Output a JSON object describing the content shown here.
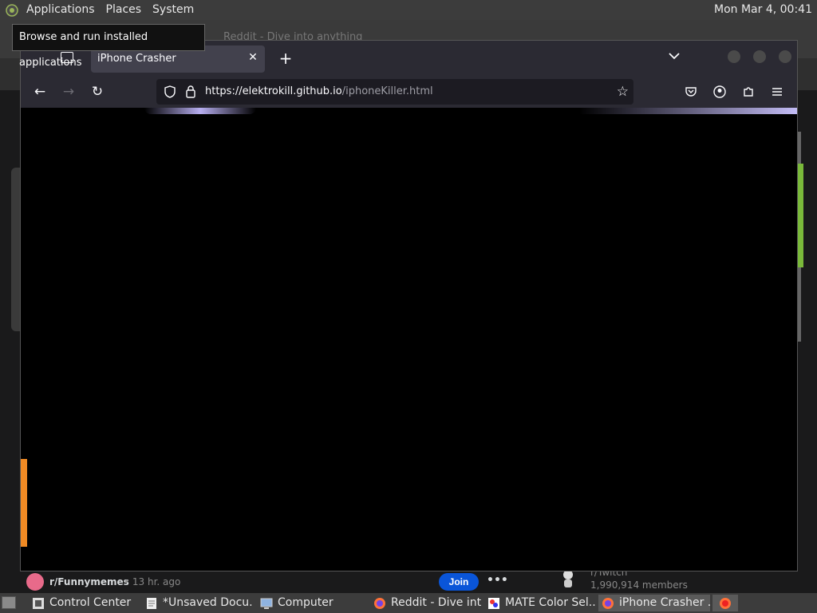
{
  "top_panel": {
    "menus": [
      "Applications",
      "Places",
      "System"
    ],
    "clock": "Mon Mar  4, 00:41"
  },
  "tooltip": "Browse and run installed applications",
  "background_window": {
    "ghost_tab": "Reddit - Dive into anything",
    "post": {
      "subreddit": "r/Funnymemes",
      "time": "• 13 hr. ago",
      "join": "Join",
      "more": "•••"
    },
    "sidebar": {
      "subreddit": "r/Twitch",
      "members": "1,990,914 members"
    }
  },
  "browser": {
    "tab_title": "iPhone Crasher",
    "url_host": "https://elektrokill.github.io",
    "url_path": "/iphoneKiller.html"
  },
  "taskbar": {
    "items": [
      {
        "label": "Control Center",
        "icon": "control-center-icon"
      },
      {
        "label": "*Unsaved Docu...",
        "icon": "text-editor-icon"
      },
      {
        "label": "Computer",
        "icon": "computer-icon"
      },
      {
        "label": "Reddit - Dive int...",
        "icon": "firefox-icon"
      },
      {
        "label": "MATE Color Sel...",
        "icon": "color-selector-icon"
      },
      {
        "label": "iPhone Crasher ...",
        "icon": "firefox-icon"
      }
    ]
  },
  "colors": {
    "panel": "#3c3c3c",
    "browser_chrome": "#2b2a33",
    "join_button": "#0a55d8",
    "orange_strip": "#f08a24"
  }
}
